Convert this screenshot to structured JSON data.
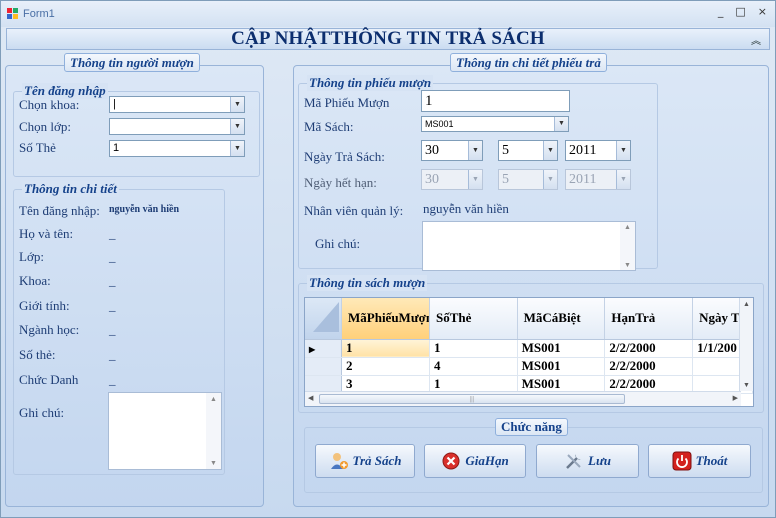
{
  "window": {
    "title": "Form1",
    "minimize": "_",
    "maximize": "□",
    "close": "×"
  },
  "header": {
    "title": "CẬP NHẬTTHÔNG TIN TRẢ SÁCH",
    "collapse": "«"
  },
  "left_panel": {
    "tab": "Thông tin người mượn",
    "login": {
      "legend": "Tên đăng nhập",
      "khoa_label": "Chọn khoa:",
      "khoa_value": "",
      "lop_label": "Chọn lớp:",
      "lop_value": "",
      "sothe_label": "Số Thẻ",
      "sothe_value": "1"
    },
    "detail": {
      "legend": "Thông tin chi tiết",
      "username_label": "Tên đăng nhập:",
      "username_value": "nguyễn văn hiền",
      "hoten_label": "Họ và tên:",
      "hoten_value": "_",
      "lop_label": "Lớp:",
      "lop_value": "_",
      "khoa_label": "Khoa:",
      "khoa_value": "_",
      "gioitinh_label": "Giới tính:",
      "gioitinh_value": "_",
      "nganh_label": "Ngành học:",
      "nganh_value": "_",
      "sothe_label": "Số thẻ:",
      "sothe_value": "_",
      "chucdanh_label": "Chức Danh",
      "chucdanh_value": "_",
      "ghichu_label": "Ghi chú:"
    }
  },
  "right_panel": {
    "tab": "Thông tin chi tiết phiếu trả",
    "slip": {
      "legend": "Thông tin phiếu mượn",
      "maphieu_label": "Mã Phiếu Mượn",
      "maphieu_value": "1",
      "masach_label": "Mã Sách:",
      "masach_value": "MS001",
      "ngaytra_label": "Ngày Trả Sách:",
      "ngaytra_day": "30",
      "ngaytra_month": "5",
      "ngaytra_year": "2011",
      "ngayhethan_label": "Ngày hết hạn:",
      "ngayhethan_day": "30",
      "ngayhethan_month": "5",
      "ngayhethan_year": "2011",
      "nhanvien_label": "Nhân viên quản lý:",
      "nhanvien_value": "nguyễn văn hiền",
      "ghichu_label": "Ghi chú:"
    },
    "books": {
      "legend": "Thông tin sách mượn",
      "columns": [
        "MãPhiếuMượn",
        "SốThẻ",
        "MãCáBiệt",
        "HạnTrả",
        "Ngày T"
      ],
      "rows": [
        [
          "1",
          "1",
          "MS001",
          "2/2/2000",
          "1/1/200"
        ],
        [
          "2",
          "4",
          "MS001",
          "2/2/2000",
          ""
        ],
        [
          "3",
          "1",
          "MS001",
          "2/2/2000",
          ""
        ]
      ]
    },
    "actions": {
      "legend": "Chức năng",
      "tra_sach": "Trả Sách",
      "gia_han": "GiaHạn",
      "luu": "Lưu",
      "thoat": "Thoát"
    }
  }
}
